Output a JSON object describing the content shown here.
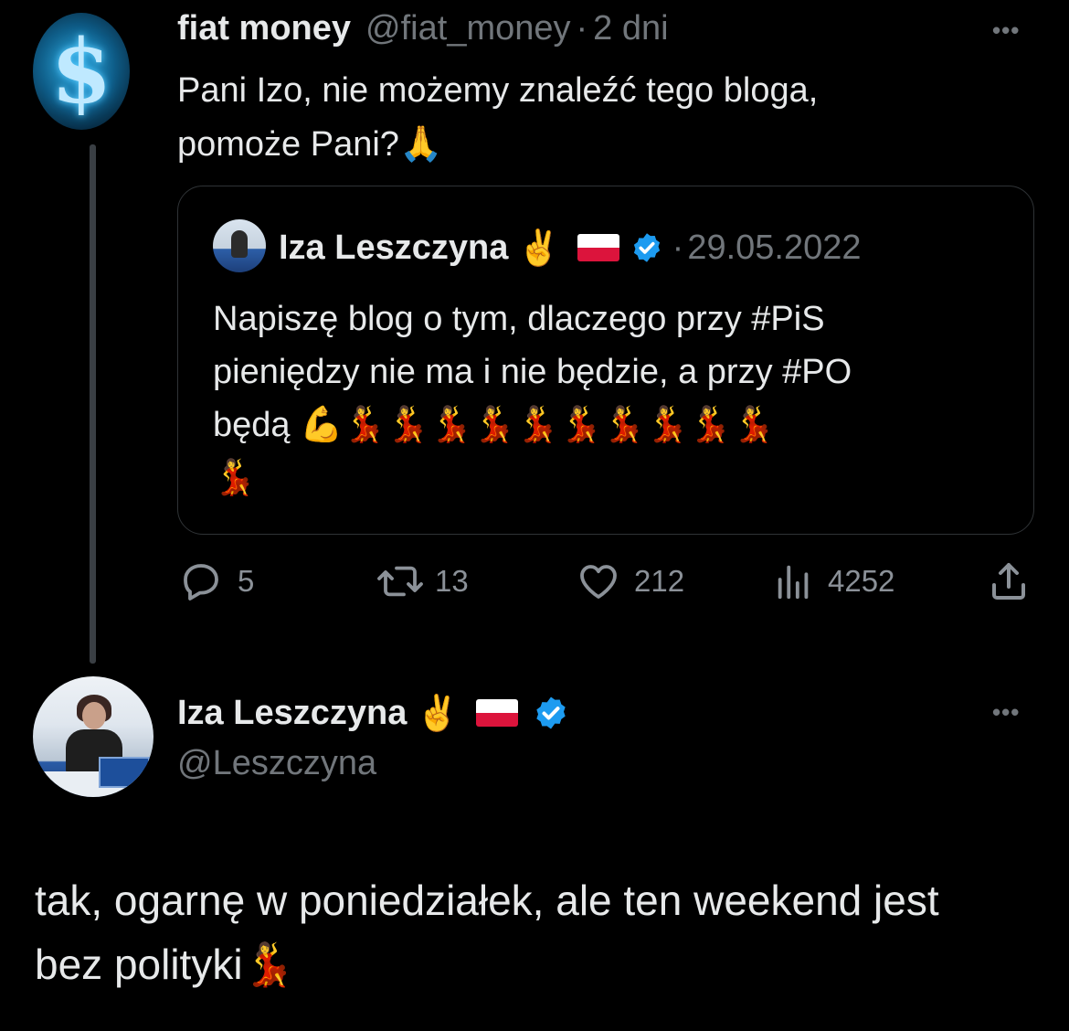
{
  "tweet": {
    "author_name": "fiat money",
    "author_handle": "@fiat_money",
    "time_separator": "·",
    "time": "2 dni",
    "text_line1": "Pani Izo, nie możemy znaleźć tego bloga,",
    "text_line2": "pomoże Pani?",
    "text_emoji": "🙏",
    "more_label": "•••",
    "avatar_icon": "dollar-sign-logo",
    "avatar_glyph": "$"
  },
  "quoted_tweet": {
    "author_name": "Iza Leszczyna",
    "victory_emoji": "✌️",
    "time_separator": "·",
    "date": "29.05.2022",
    "text_line1": "Napiszę blog o tym, dlaczego przy #PiS",
    "text_line2": "pieniędzy nie ma i nie będzie, a przy #PO",
    "text_line3": "będą 💪💃💃💃💃💃💃💃💃💃💃",
    "text_line4": "💃"
  },
  "actions": {
    "reply_count": "5",
    "retweet_count": "13",
    "like_count": "212",
    "views_count": "4252"
  },
  "reply": {
    "author_name": "Iza Leszczyna",
    "victory_emoji": "✌️",
    "author_handle": "@Leszczyna",
    "more_label": "•••",
    "text_line1": "tak, ogarnę w poniedziałek, ale ten weekend jest",
    "text_line2": "bez polityki💃"
  },
  "colors": {
    "background": "#000000",
    "text": "#e7e9ea",
    "muted": "#71767b",
    "verified": "#1d9bf0",
    "border": "#2f3336"
  }
}
